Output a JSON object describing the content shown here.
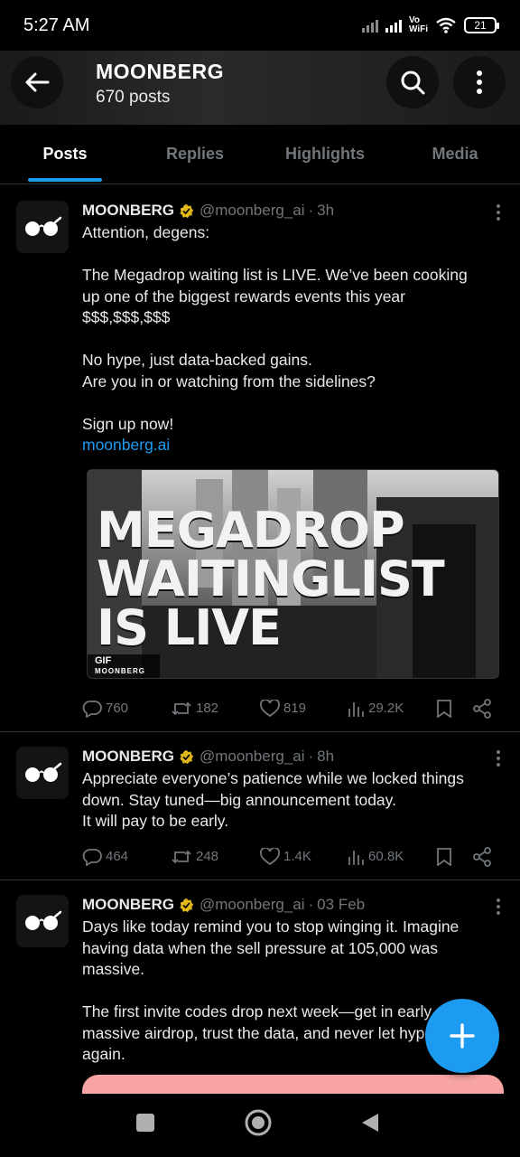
{
  "status_bar": {
    "time": "5:27 AM",
    "vowifi": [
      "Vo",
      "WiFi"
    ],
    "battery": "21"
  },
  "profile": {
    "name": "MOONBERG",
    "posts_count": "670 posts"
  },
  "tabs": [
    {
      "label": "Posts",
      "active": true
    },
    {
      "label": "Replies",
      "active": false
    },
    {
      "label": "Highlights",
      "active": false
    },
    {
      "label": "Media",
      "active": false
    }
  ],
  "posts": [
    {
      "author": "MOONBERG",
      "handle": "@moonberg_ai",
      "time": "3h",
      "text": "Attention, degens:\n\nThe Megadrop waiting list is LIVE. We’ve been cooking up one of the biggest rewards events this year $$$,$$$,$$$\n\nNo hype, just data-backed gains.\nAre you in or watching from the sidelines?\n\nSign up now!",
      "link": "moonberg.ai",
      "media": {
        "lines": [
          "MEGADROP",
          "WAITINGLIST",
          "IS LIVE"
        ],
        "gif_label": "GIF",
        "watermark": "MOONBERG"
      },
      "replies": "760",
      "reposts": "182",
      "likes": "819",
      "views": "29.2K"
    },
    {
      "author": "MOONBERG",
      "handle": "@moonberg_ai",
      "time": "8h",
      "text": "Appreciate everyone’s patience while we locked things down. Stay tuned—big announcement today.\nIt will pay to be early.",
      "replies": "464",
      "reposts": "248",
      "likes": "1.4K",
      "views": "60.8K"
    },
    {
      "author": "MOONBERG",
      "handle": "@moonberg_ai",
      "time": "03 Feb",
      "text": "Days like today remind you to stop winging it. Imagine having data when the sell pressure at 105,000 was massive.\n\nThe first invite codes drop next week—get in early massive airdrop, trust the data, and never let hype you again."
    }
  ],
  "colors": {
    "accent": "#1d9bf0",
    "verified": "#e2b719",
    "muted": "#71767b",
    "background": "#000000"
  }
}
